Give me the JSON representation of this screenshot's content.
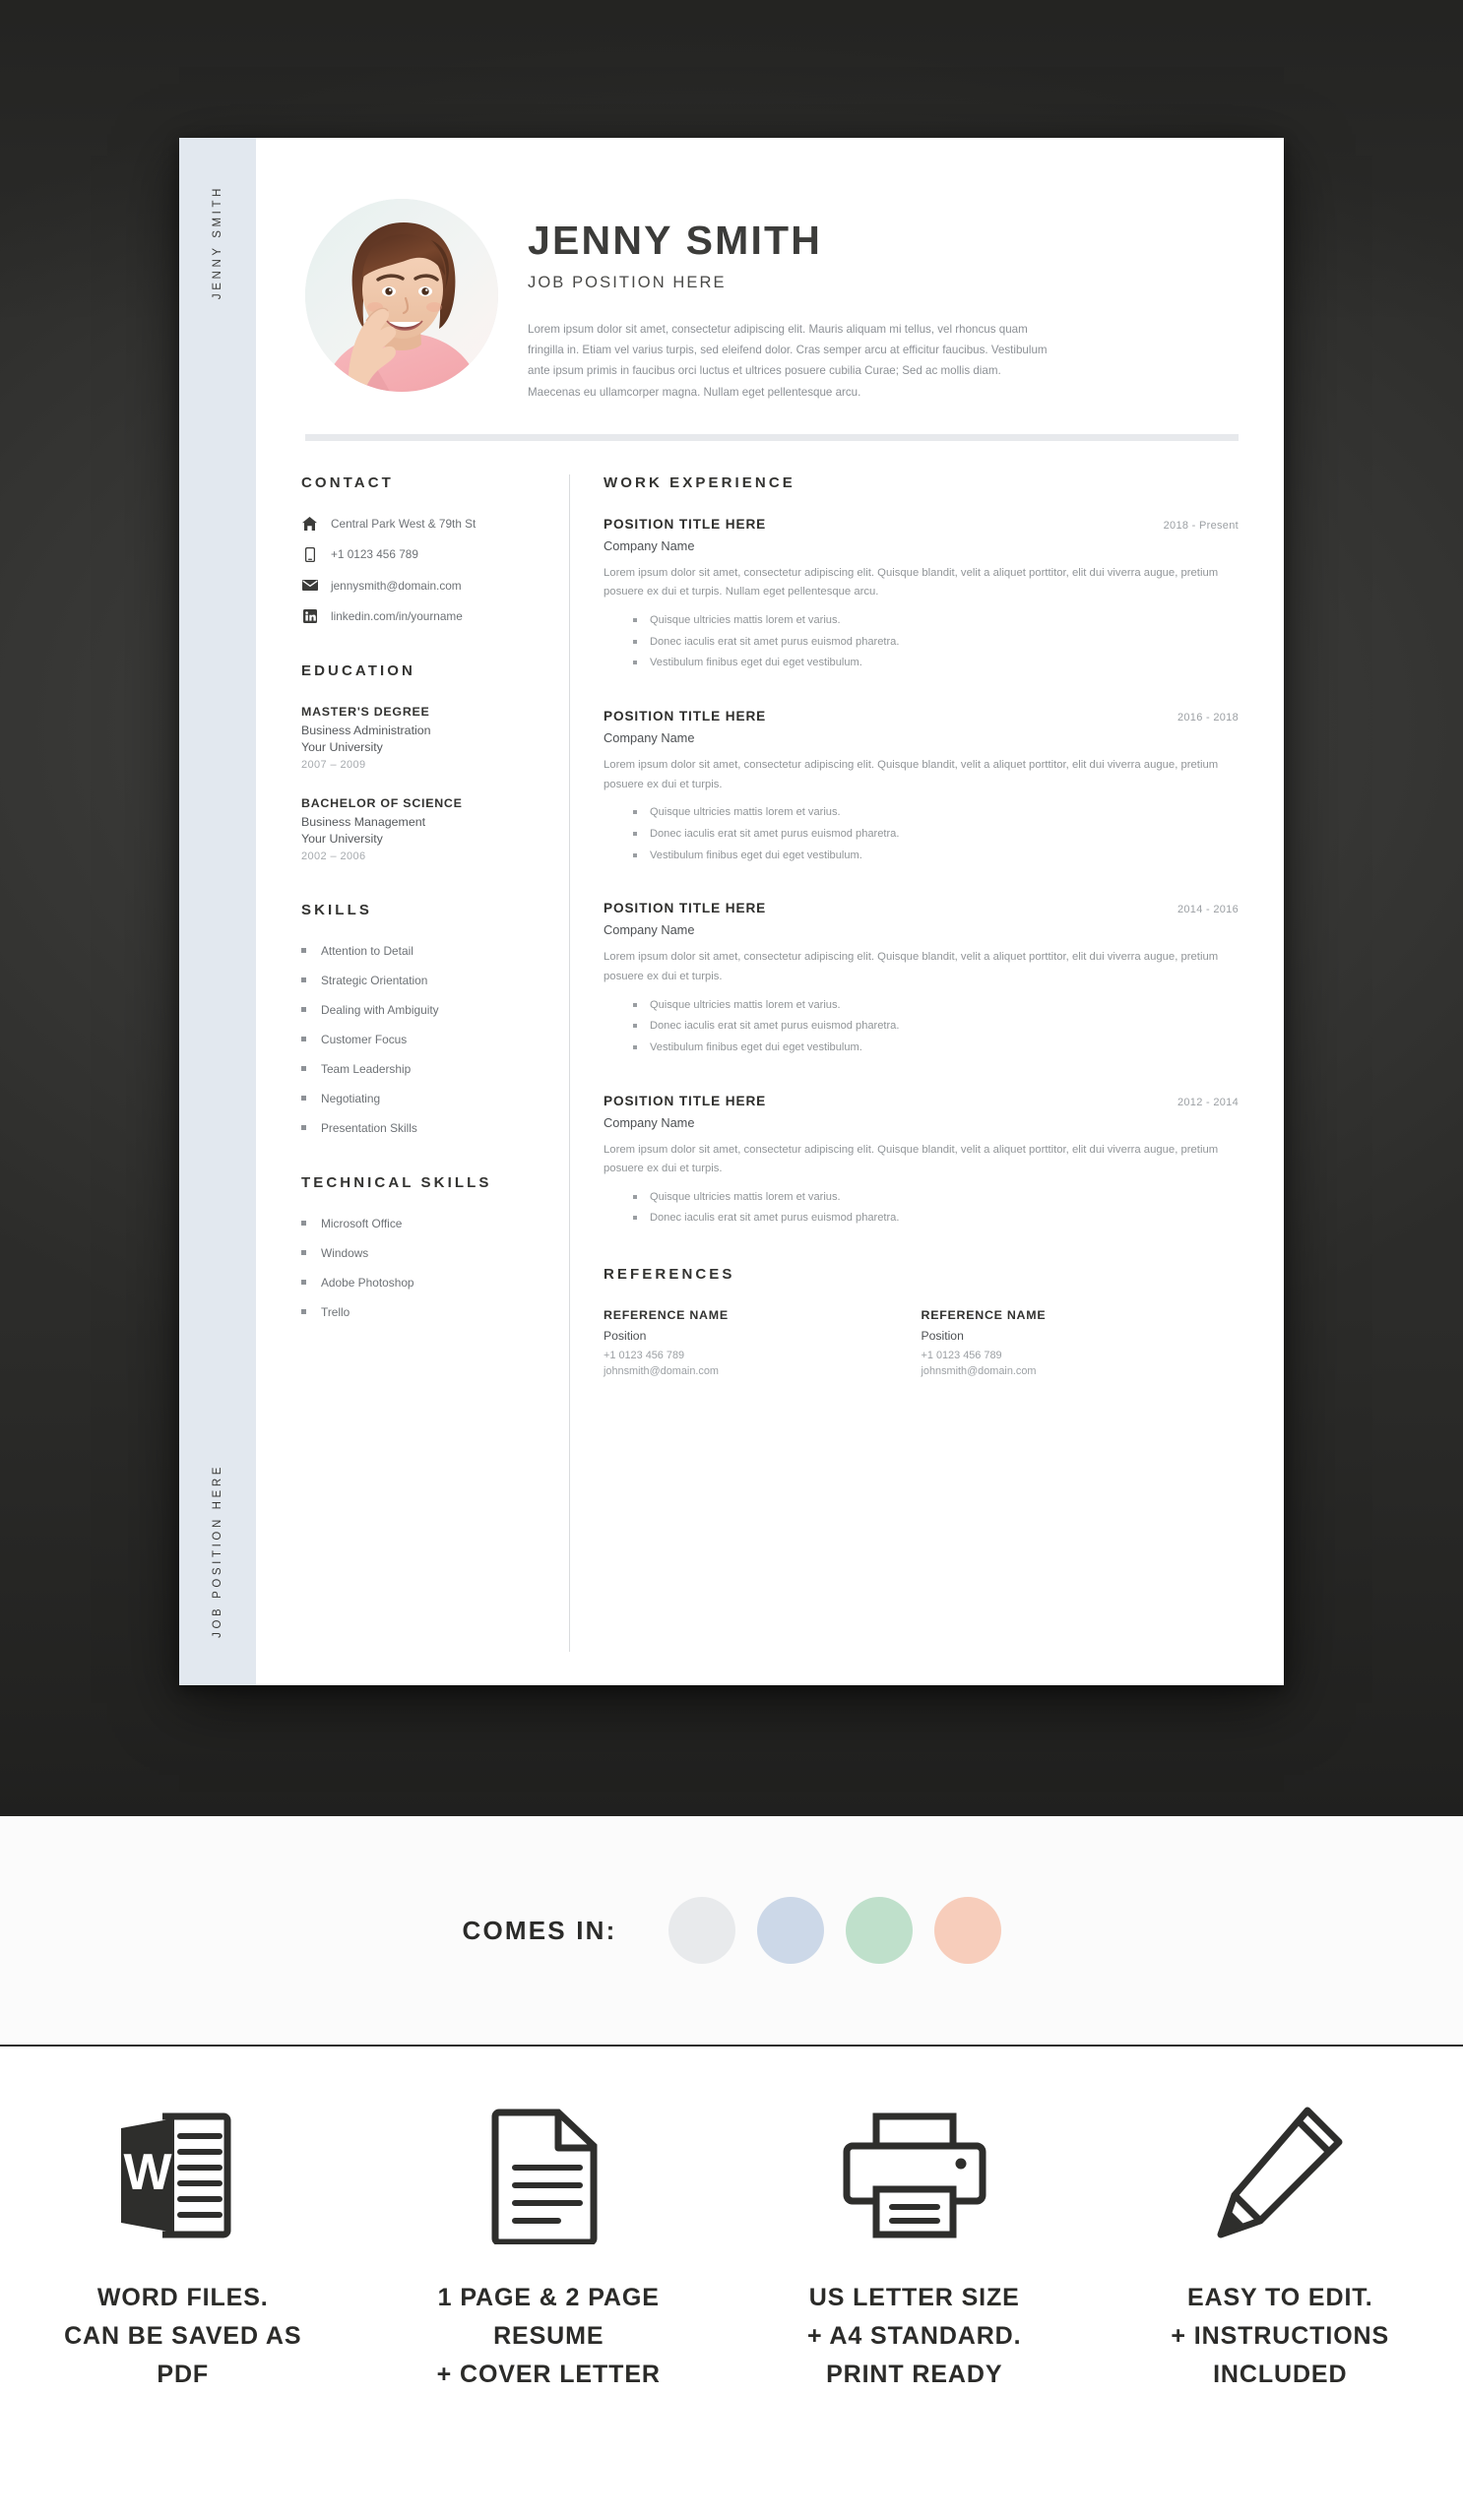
{
  "resume": {
    "side_strip": {
      "top_label": "JENNY SMITH",
      "bottom_label": "JOB POSITION HERE"
    },
    "header": {
      "name": "JENNY SMITH",
      "role": "JOB POSITION HERE",
      "summary": "Lorem ipsum dolor sit amet, consectetur adipiscing elit. Mauris aliquam mi tellus, vel rhoncus quam fringilla in. Etiam vel varius turpis, sed eleifend dolor. Cras semper arcu at efficitur faucibus. Vestibulum ante ipsum primis in faucibus orci luctus et ultrices posuere cubilia Curae; Sed ac mollis diam. Maecenas eu ullamcorper magna. Nullam eget pellentesque arcu."
    },
    "contact": {
      "title": "CONTACT",
      "items": [
        {
          "icon": "home-icon",
          "text": "Central Park West & 79th St"
        },
        {
          "icon": "phone-icon",
          "text": "+1 0123 456 789"
        },
        {
          "icon": "envelope-icon",
          "text": "jennysmith@domain.com"
        },
        {
          "icon": "linkedin-icon",
          "text": "linkedin.com/in/yourname"
        }
      ]
    },
    "education": {
      "title": "EDUCATION",
      "items": [
        {
          "degree": "MASTER'S DEGREE",
          "field": "Business Administration",
          "university": "Your University",
          "years": "2007 – 2009"
        },
        {
          "degree": "BACHELOR OF SCIENCE",
          "field": "Business Management",
          "university": "Your University",
          "years": "2002 – 2006"
        }
      ]
    },
    "skills": {
      "title": "SKILLS",
      "items": [
        "Attention to Detail",
        "Strategic Orientation",
        "Dealing with Ambiguity",
        "Customer Focus",
        "Team Leadership",
        "Negotiating",
        "Presentation Skills"
      ]
    },
    "technical_skills": {
      "title": "TECHNICAL SKILLS",
      "items": [
        "Microsoft Office",
        "Windows",
        "Adobe Photoshop",
        "Trello"
      ]
    },
    "work_experience": {
      "title": "WORK EXPERIENCE",
      "jobs": [
        {
          "title": "POSITION TITLE HERE",
          "date": "2018 - Present",
          "company": "Company Name",
          "description": "Lorem ipsum dolor sit amet, consectetur adipiscing elit. Quisque blandit, velit a aliquet porttitor, elit dui viverra augue, pretium posuere ex dui et turpis. Nullam eget pellentesque arcu.",
          "bullets": [
            "Quisque ultricies mattis lorem et varius.",
            "Donec iaculis erat sit amet purus euismod pharetra.",
            "Vestibulum finibus eget dui eget vestibulum."
          ]
        },
        {
          "title": "POSITION TITLE HERE",
          "date": "2016 - 2018",
          "company": "Company Name",
          "description": "Lorem ipsum dolor sit amet, consectetur adipiscing elit. Quisque blandit, velit a aliquet porttitor, elit dui viverra augue, pretium posuere ex dui et turpis.",
          "bullets": [
            "Quisque ultricies mattis lorem et varius.",
            "Donec iaculis erat sit amet purus euismod pharetra.",
            "Vestibulum finibus eget dui eget vestibulum."
          ]
        },
        {
          "title": "POSITION TITLE HERE",
          "date": "2014 - 2016",
          "company": "Company Name",
          "description": "Lorem ipsum dolor sit amet, consectetur adipiscing elit. Quisque blandit, velit a aliquet porttitor, elit dui viverra augue, pretium posuere ex dui et turpis.",
          "bullets": [
            "Quisque ultricies mattis lorem et varius.",
            "Donec iaculis erat sit amet purus euismod pharetra.",
            "Vestibulum finibus eget dui eget vestibulum."
          ]
        },
        {
          "title": "POSITION TITLE HERE",
          "date": "2012 - 2014",
          "company": "Company Name",
          "description": "Lorem ipsum dolor sit amet, consectetur adipiscing elit. Quisque blandit, velit a aliquet porttitor, elit dui viverra augue, pretium posuere ex dui et turpis.",
          "bullets": [
            "Quisque ultricies mattis lorem et varius.",
            "Donec iaculis erat sit amet purus euismod pharetra."
          ]
        }
      ]
    },
    "references": {
      "title": "REFERENCES",
      "items": [
        {
          "name": "REFERENCE NAME",
          "position": "Position",
          "phone": "+1 0123 456 789",
          "email": "johnsmith@domain.com"
        },
        {
          "name": "REFERENCE NAME",
          "position": "Position",
          "phone": "+1 0123 456 789",
          "email": "johnsmith@domain.com"
        }
      ]
    }
  },
  "comes_in": {
    "label": "COMES IN:",
    "swatches": [
      {
        "name": "light-gray",
        "color": "#e8eaec"
      },
      {
        "name": "light-blue",
        "color": "#ccd8e8"
      },
      {
        "name": "mint-green",
        "color": "#bfe0cb"
      },
      {
        "name": "peach",
        "color": "#f7cdbb"
      }
    ]
  },
  "features": [
    {
      "icon": "word-document-icon",
      "lines": [
        "WORD FILES.",
        "CAN BE SAVED AS",
        "PDF"
      ]
    },
    {
      "icon": "document-pages-icon",
      "lines": [
        "1 PAGE & 2 PAGE",
        "RESUME",
        "+ COVER LETTER"
      ]
    },
    {
      "icon": "printer-icon",
      "lines": [
        "US LETTER SIZE",
        "+ A4 STANDARD.",
        "PRINT READY"
      ]
    },
    {
      "icon": "pencil-icon",
      "lines": [
        "EASY TO EDIT.",
        "+ INSTRUCTIONS",
        "INCLUDED"
      ]
    }
  ]
}
